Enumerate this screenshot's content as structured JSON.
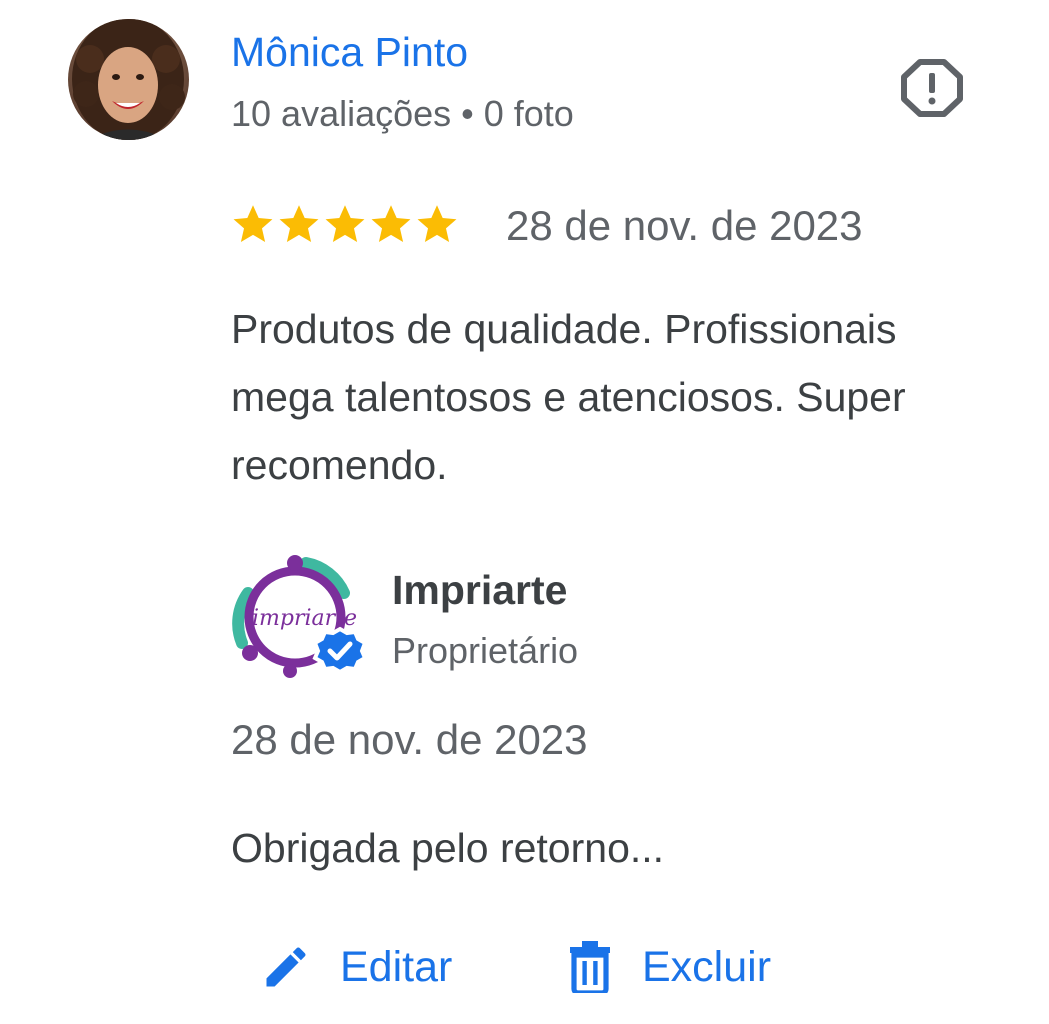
{
  "review": {
    "reviewer_name": "Mônica Pinto",
    "reviewer_meta": "10 avaliações • 0 foto",
    "rating": 5,
    "rating_max": 5,
    "date": "28 de nov. de 2023",
    "text": "Produtos de qualidade. Profissionais mega talentosos e atenciosos. Super recomendo."
  },
  "owner_response": {
    "name": "Impriarte",
    "role": "Proprietário",
    "logo_text": "impriarte",
    "date": "28 de nov. de 2023",
    "text": "Obrigada pelo retorno..."
  },
  "actions": {
    "edit_label": "Editar",
    "delete_label": "Excluir"
  },
  "icons": {
    "report": "report-octagon-icon",
    "star": "star-icon",
    "verified": "verified-badge-icon",
    "edit": "pencil-icon",
    "delete": "trash-icon"
  },
  "colors": {
    "accent": "#1a73e8",
    "star": "#fbbc04",
    "text_primary": "#3c4043",
    "text_secondary": "#5f6368",
    "logo_purple": "#7b2f9b",
    "logo_teal": "#3fb8a0"
  }
}
